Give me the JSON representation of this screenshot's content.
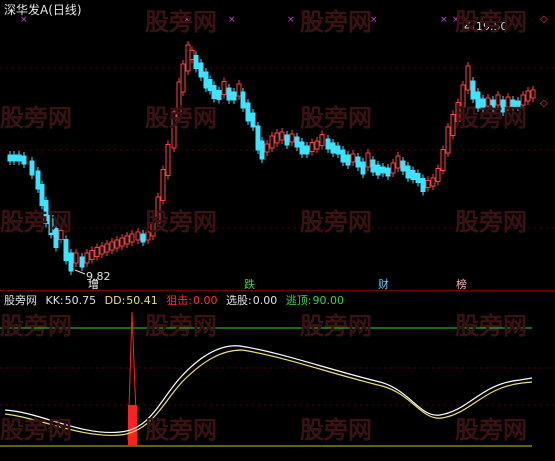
{
  "header": {
    "title": "深华发A(日线)"
  },
  "price_panel": {
    "high_marker": "19.50",
    "low_marker": "9.82",
    "signals": [
      {
        "text": "增",
        "color": "#ffffff"
      },
      {
        "text": "跌",
        "color": "#39d353"
      },
      {
        "text": "财",
        "color": "#6ec3ff"
      },
      {
        "text": "榜",
        "color": "#ffb0b0"
      }
    ]
  },
  "indicator_panel": {
    "name": "股旁网",
    "kk_label": "KK:",
    "kk_value": "50.75",
    "dd_label": "DD:",
    "dd_value": "50.41",
    "zj_label": "狙击:",
    "zj_value": "0.00",
    "xg_label": "选股:",
    "xg_value": "0.00",
    "td_label": "逃顶:",
    "td_value": "90.00"
  },
  "watermark": "股旁网",
  "colors": {
    "up": "#ff4040",
    "down": "#3fe3ff",
    "kk": "#ffffff",
    "dd": "#e8e070",
    "top_line": "#3ad13a",
    "bottom_line": "#c8c800",
    "spike": "#ff2020"
  }
}
